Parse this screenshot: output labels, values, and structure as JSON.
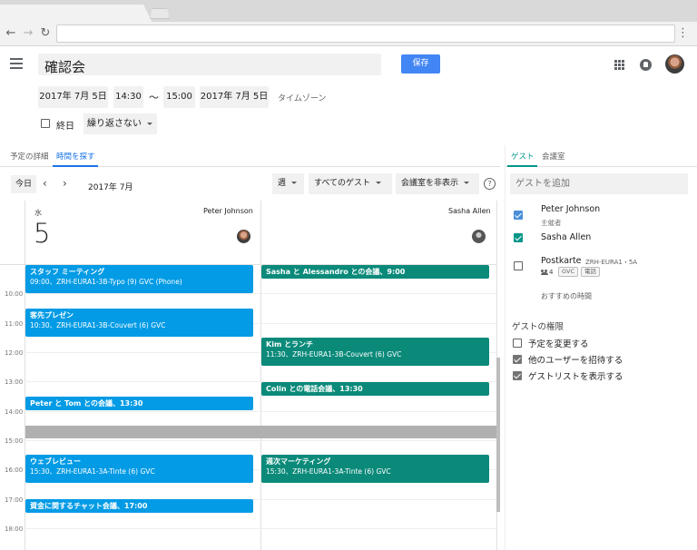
{
  "header": {
    "title": "確認会",
    "save_label": "保存"
  },
  "datetime": {
    "start_date": "2017年 7月 5日",
    "start_time": "14:30",
    "separator": "〜",
    "end_time": "15:00",
    "end_date": "2017年 7月 5日",
    "timezone_label": "タイムゾーン",
    "all_day_label": "終日",
    "all_day_checked": false,
    "repeat_value": "繰り返さない"
  },
  "tabs_left": [
    {
      "label": "予定の詳細",
      "active": false
    },
    {
      "label": "時間を探す",
      "active": true
    }
  ],
  "tabs_right": [
    {
      "label": "ゲスト",
      "active": true
    },
    {
      "label": "会議室",
      "active": false
    }
  ],
  "calendar_toolbar": {
    "today_label": "今日",
    "month_label": "2017年 7月",
    "view_select": "週",
    "guests_select": "すべてのゲスト",
    "rooms_select": "会議室を非表示",
    "help": "?"
  },
  "day": {
    "dow": "水",
    "number": "5"
  },
  "columns": [
    {
      "person": "Peter Johnson"
    },
    {
      "person": "Sasha Allen"
    }
  ],
  "hours": [
    "10:00",
    "11:00",
    "12:00",
    "13:00",
    "14:00",
    "15:00",
    "16:00",
    "17:00",
    "18:00"
  ],
  "events_left": [
    {
      "title": "スタッフ ミーティング",
      "detail": "09:00、ZRH-EURA1-3B-Typo (9) GVC (Phone)"
    },
    {
      "title": "客先プレゼン",
      "detail": "10:30、ZRH-EURA1-3B-Couvert (6) GVC"
    },
    {
      "title": "Peter と Tom との会議、13:30",
      "detail": ""
    },
    {
      "title": "ウェブレビュー",
      "detail": "15:30、ZRH-EURA1-3A-Tinte (6) GVC"
    },
    {
      "title": "資金に関するチャット会議、17:00",
      "detail": ""
    }
  ],
  "events_right": [
    {
      "title": "Sasha と Alessandro との会議、9:00",
      "detail": ""
    },
    {
      "title": "Kim とランチ",
      "detail": "11:30、ZRH-EURA1-3B-Couvert (6) GVC"
    },
    {
      "title": "Colin との電話会議、13:30",
      "detail": ""
    },
    {
      "title": "週次マーケティング",
      "detail": "15:30、ZRH-EURA1-3A-Tinte (6) GVC"
    }
  ],
  "guests_panel": {
    "add_placeholder": "ゲストを追加",
    "guests": [
      {
        "name": "Peter Johnson",
        "role": "主催者",
        "checked": true
      },
      {
        "name": "Sasha Allen",
        "role": "",
        "checked": true
      }
    ],
    "room": {
      "name": "Postkarte",
      "location": "ZRH-EURA1・5A",
      "capacity": "4",
      "tags": [
        "GVC",
        "電話"
      ],
      "checked": false
    },
    "suggested_times": "おすすめの時間",
    "permissions_title": "ゲストの権限",
    "permissions": [
      {
        "label": "予定を変更する",
        "checked": false
      },
      {
        "label": "他のユーザーを招待する",
        "checked": true
      },
      {
        "label": "ゲストリストを表示する",
        "checked": true
      }
    ]
  },
  "colors": {
    "accent_blue": "#4285f4",
    "event_blue": "#039be5",
    "event_teal": "#0b8a7a",
    "guest_teal": "#009688"
  }
}
